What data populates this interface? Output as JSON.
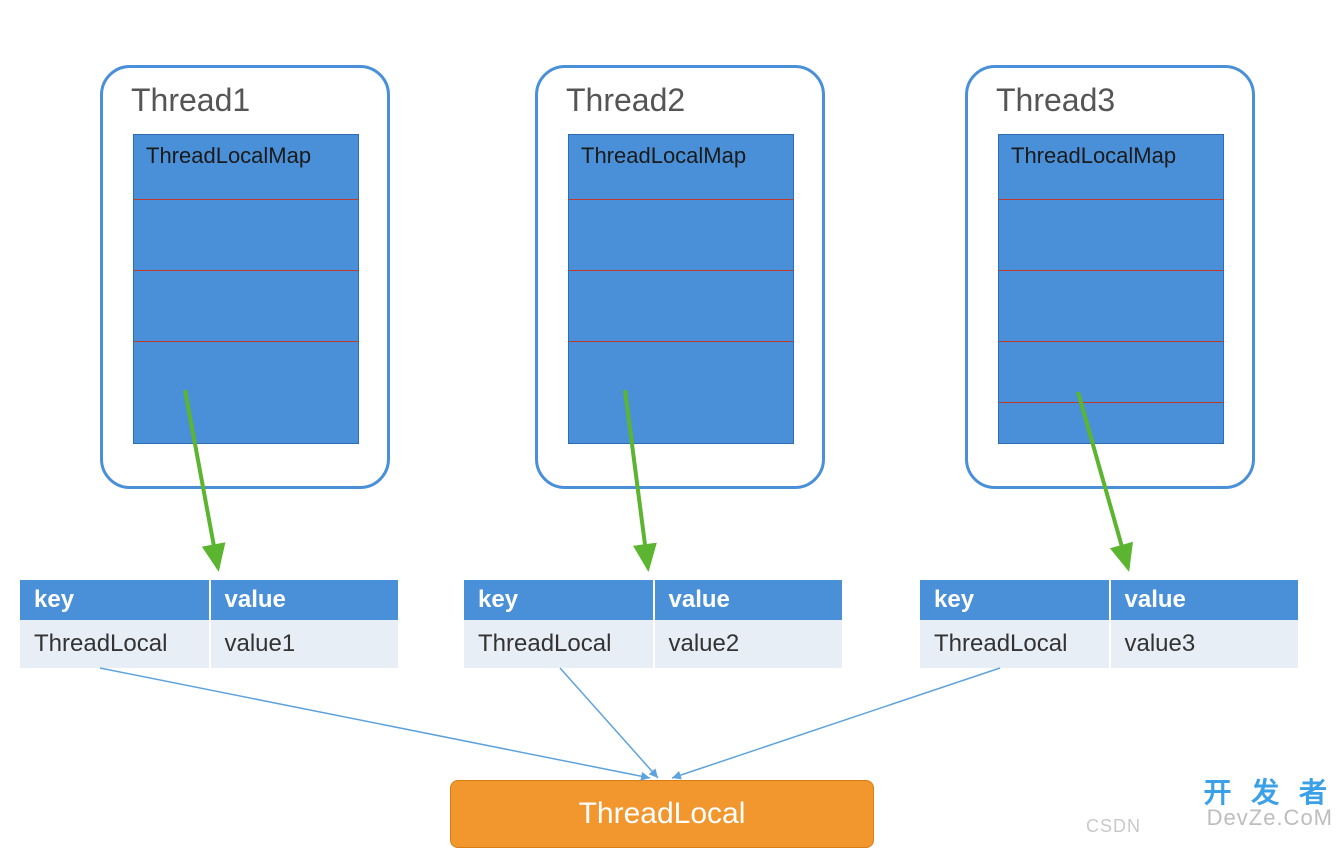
{
  "threads": [
    {
      "title": "Thread1",
      "mapLabel": "ThreadLocalMap"
    },
    {
      "title": "Thread2",
      "mapLabel": "ThreadLocalMap"
    },
    {
      "title": "Thread3",
      "mapLabel": "ThreadLocalMap"
    }
  ],
  "tables": [
    {
      "keyHeader": "key",
      "valueHeader": "value",
      "keyCell": "ThreadLocal",
      "valueCell": "value1"
    },
    {
      "keyHeader": "key",
      "valueHeader": "value",
      "keyCell": "ThreadLocal",
      "valueCell": "value2"
    },
    {
      "keyHeader": "key",
      "valueHeader": "value",
      "keyCell": "ThreadLocal",
      "valueCell": "value3"
    }
  ],
  "threadLocalLabel": "ThreadLocal",
  "watermark": {
    "topChinese": "开 发 者",
    "devze": "DevZe.CoM",
    "csdn": "CSDN"
  },
  "layout": {
    "threadX": [
      100,
      535,
      965
    ],
    "threadY": 65,
    "tableX": [
      20,
      464,
      920
    ],
    "tableY": 580
  },
  "colors": {
    "blue": "#4a90d9",
    "orange": "#f2962e",
    "greenArrow": "#5cb531",
    "blueThinArrow": "#5fa3dc"
  }
}
